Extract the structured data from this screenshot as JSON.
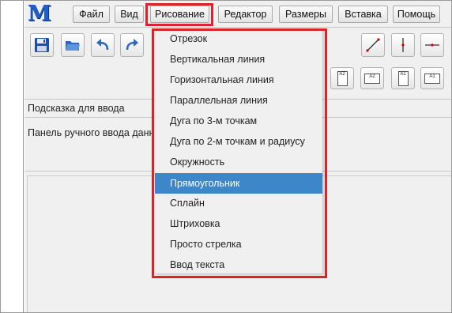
{
  "logo_text": "M",
  "menu": {
    "items": [
      {
        "label": "Файл"
      },
      {
        "label": "Вид"
      },
      {
        "label": "Рисование"
      },
      {
        "label": "Редактор"
      },
      {
        "label": "Размеры"
      },
      {
        "label": "Вставка"
      },
      {
        "label": "Помощь"
      }
    ],
    "active": "Рисование"
  },
  "toolbar": {
    "icons": [
      "save-icon",
      "open-folder-icon",
      "undo-icon",
      "redo-icon",
      "diagonal-line-icon",
      "vertical-line-icon",
      "horizontal-line-icon"
    ],
    "format_buttons": [
      "A2",
      "A2",
      "A1",
      "A1"
    ]
  },
  "hint": {
    "text": "Подсказка для ввода"
  },
  "input_panel": {
    "text": "Панель ручного ввода данных"
  },
  "dropdown": {
    "items": [
      {
        "label": "Отрезок"
      },
      {
        "label": "Вертикальная линия"
      },
      {
        "label": "Горизонтальная линия"
      },
      {
        "label": "Параллельная линия"
      },
      {
        "label": "Дуга по 3-м точкам"
      },
      {
        "label": "Дуга по 2-м точкам и радиусу"
      },
      {
        "label": "Окружность"
      },
      {
        "label": "Прямоугольник"
      },
      {
        "label": "Сплайн"
      },
      {
        "label": "Штриховка"
      },
      {
        "label": "Просто стрелка"
      },
      {
        "label": "Ввод текста"
      }
    ],
    "selected": "Прямоугольник"
  },
  "colors": {
    "highlight_frame": "#d9242b",
    "selection": "#3d86c8",
    "logo": "#1f5fc8",
    "panel_bg": "#f0f0f0"
  }
}
